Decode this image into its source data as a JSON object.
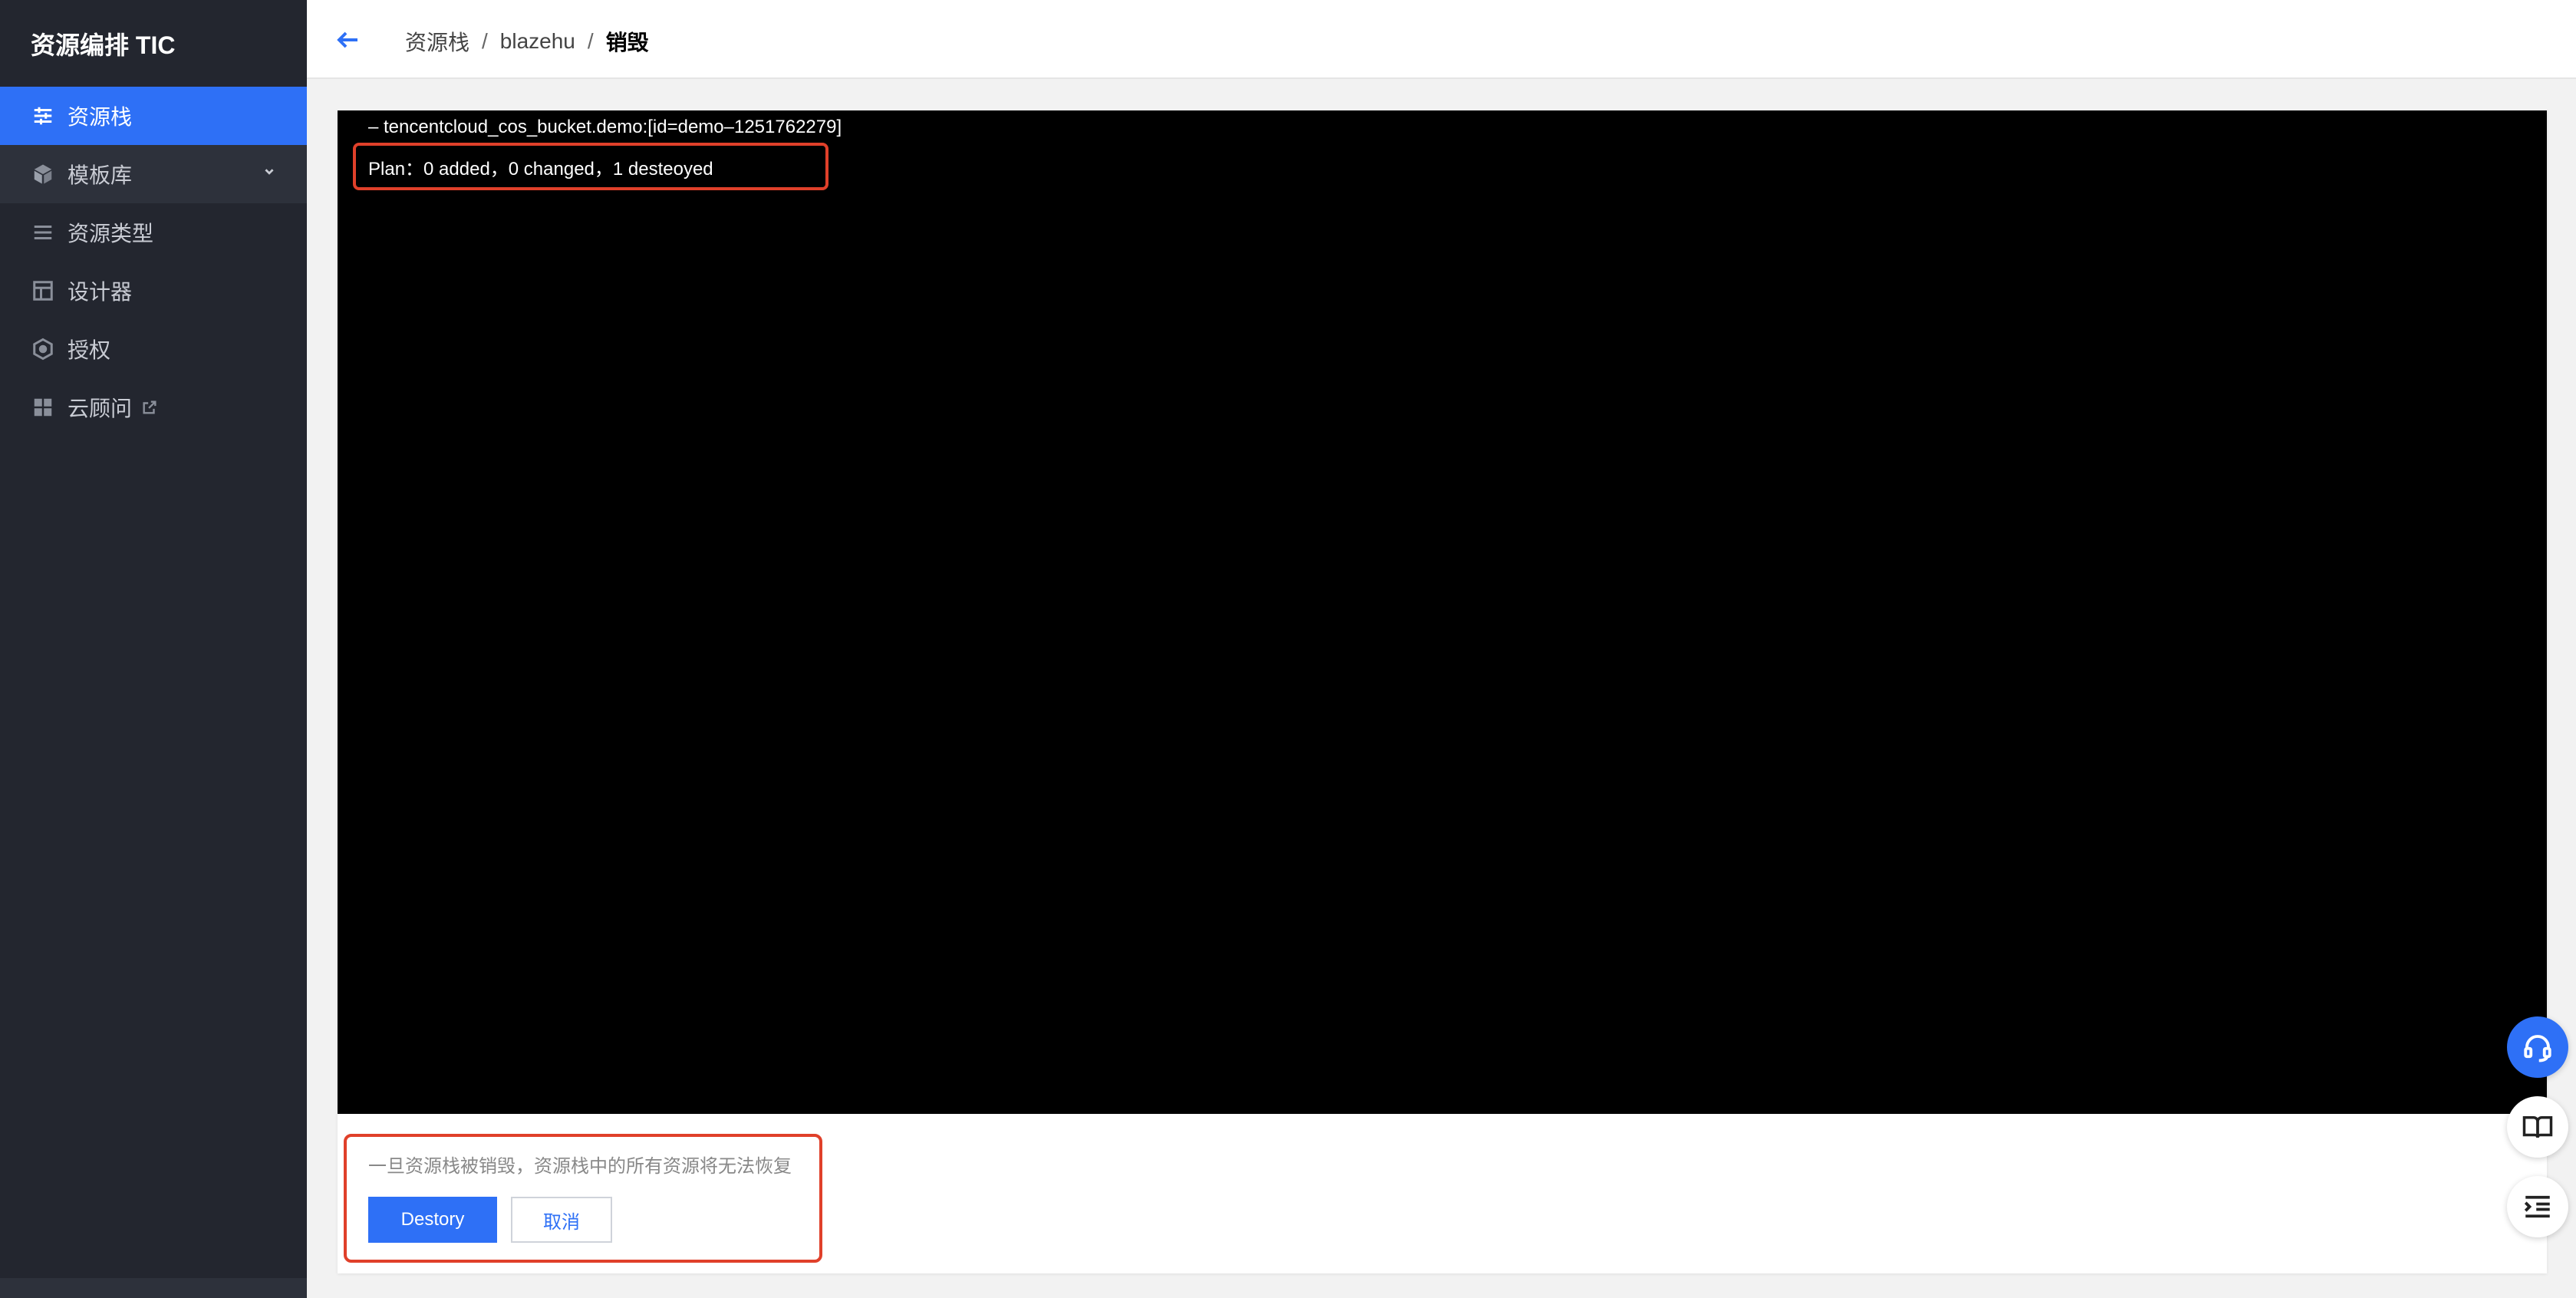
{
  "app": {
    "title": "资源编排 TIC"
  },
  "sidebar": {
    "items": [
      {
        "label": "资源栈",
        "icon": "sliders-icon",
        "active": true
      },
      {
        "label": "模板库",
        "icon": "cube-icon",
        "expandable": true
      },
      {
        "label": "资源类型",
        "icon": "list-icon"
      },
      {
        "label": "设计器",
        "icon": "layout-icon"
      },
      {
        "label": "授权",
        "icon": "hexagon-icon"
      },
      {
        "label": "云顾问",
        "icon": "grid-icon",
        "external": true
      }
    ]
  },
  "breadcrumb": {
    "items": [
      "资源栈",
      "blazehu",
      "销毁"
    ],
    "separator": "/"
  },
  "terminal": {
    "lines": [
      "– tencentcloud_cos_bucket.demo:[id=demo–1251762279]",
      "Plan：0 added，0 changed，1 desteoyed"
    ]
  },
  "confirm": {
    "warning": "一旦资源栈被销毁，资源栈中的所有资源将无法恢复",
    "destroy_label": "Destory",
    "cancel_label": "取消"
  },
  "colors": {
    "sidebar_bg": "#23262f",
    "accent": "#2e70f6",
    "highlight": "#e0402a",
    "terminal_bg": "#000000"
  },
  "float_buttons": [
    "headset-icon",
    "book-icon",
    "outline-icon"
  ]
}
